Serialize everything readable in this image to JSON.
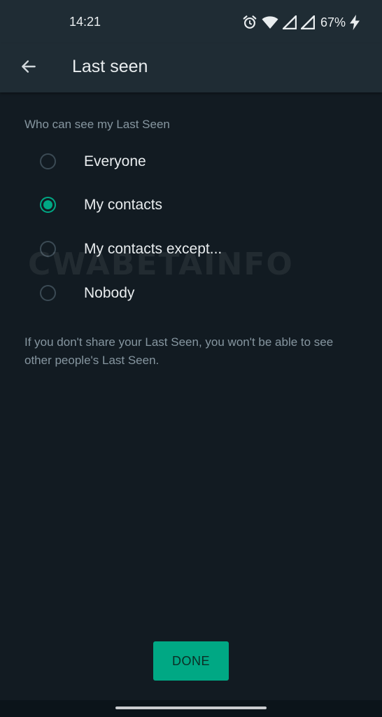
{
  "status_bar": {
    "time": "14:21",
    "battery": "67%",
    "icons": [
      "alarm-icon",
      "wifi-icon",
      "signal-icon",
      "signal-icon",
      "battery-charging-icon"
    ]
  },
  "app_bar": {
    "title": "Last seen",
    "back_icon": "arrow-left-icon"
  },
  "section_label": "Who can see my Last Seen",
  "options": [
    {
      "label": "Everyone",
      "checked": false
    },
    {
      "label": "My contacts",
      "checked": true
    },
    {
      "label": "My contacts except...",
      "checked": false
    },
    {
      "label": "Nobody",
      "checked": false
    }
  ],
  "footnote": "If you don't share your Last Seen, you won't be able to see other people's Last Seen.",
  "watermark": "CWABETAINFO",
  "done_label": "DONE",
  "colors": {
    "accent": "#00a884",
    "background": "#121b22",
    "app_bar": "#1f2c34",
    "primary_text": "#e9edef",
    "secondary_text": "#8696a0"
  }
}
